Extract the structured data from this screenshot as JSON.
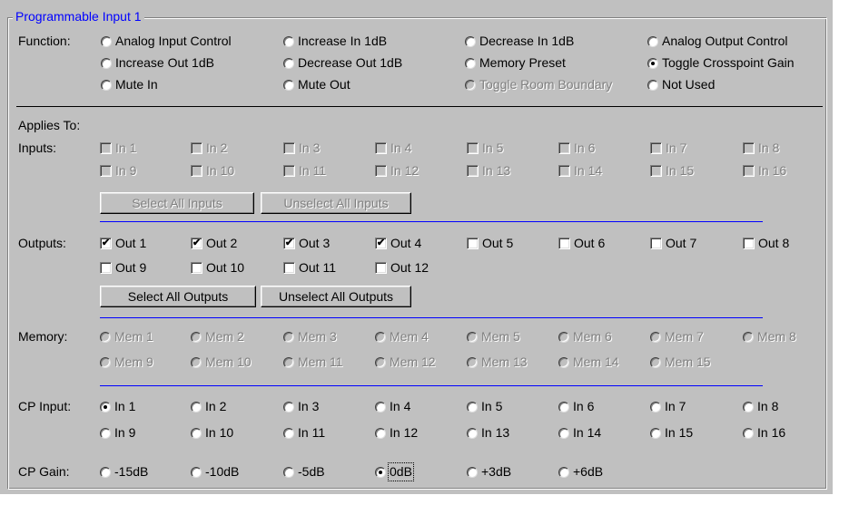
{
  "group_title": "Programmable Input 1",
  "labels": {
    "function": "Function:",
    "applies_to": "Applies To:",
    "inputs": "Inputs:",
    "outputs": "Outputs:",
    "memory": "Memory:",
    "cp_input": "CP Input:",
    "cp_gain": "CP Gain:"
  },
  "function_options": [
    {
      "label": "Analog Input Control",
      "checked": false,
      "disabled": false
    },
    {
      "label": "Increase In 1dB",
      "checked": false,
      "disabled": false
    },
    {
      "label": "Decrease In 1dB",
      "checked": false,
      "disabled": false
    },
    {
      "label": "Analog Output Control",
      "checked": false,
      "disabled": false
    },
    {
      "label": "Increase Out 1dB",
      "checked": false,
      "disabled": false
    },
    {
      "label": "Decrease Out 1dB",
      "checked": false,
      "disabled": false
    },
    {
      "label": "Memory Preset",
      "checked": false,
      "disabled": false
    },
    {
      "label": "Toggle Crosspoint Gain",
      "checked": true,
      "disabled": false
    },
    {
      "label": "Mute In",
      "checked": false,
      "disabled": false
    },
    {
      "label": "Mute Out",
      "checked": false,
      "disabled": false
    },
    {
      "label": "Toggle Room Boundary",
      "checked": false,
      "disabled": true
    },
    {
      "label": "Not Used",
      "checked": false,
      "disabled": false
    }
  ],
  "inputs": [
    {
      "label": "In 1",
      "checked": false
    },
    {
      "label": "In 2",
      "checked": false
    },
    {
      "label": "In 3",
      "checked": false
    },
    {
      "label": "In 4",
      "checked": false
    },
    {
      "label": "In 5",
      "checked": false
    },
    {
      "label": "In 6",
      "checked": false
    },
    {
      "label": "In 7",
      "checked": false
    },
    {
      "label": "In 8",
      "checked": false
    },
    {
      "label": "In 9",
      "checked": false
    },
    {
      "label": "In 10",
      "checked": false
    },
    {
      "label": "In 11",
      "checked": false
    },
    {
      "label": "In 12",
      "checked": false
    },
    {
      "label": "In 13",
      "checked": false
    },
    {
      "label": "In 14",
      "checked": false
    },
    {
      "label": "In 15",
      "checked": false
    },
    {
      "label": "In 16",
      "checked": false
    }
  ],
  "inputs_disabled": true,
  "input_buttons": {
    "select_all": "Select All Inputs",
    "unselect_all": "Unselect All Inputs"
  },
  "outputs": [
    {
      "label": "Out 1",
      "checked": true
    },
    {
      "label": "Out 2",
      "checked": true
    },
    {
      "label": "Out 3",
      "checked": true
    },
    {
      "label": "Out 4",
      "checked": true
    },
    {
      "label": "Out 5",
      "checked": false
    },
    {
      "label": "Out 6",
      "checked": false
    },
    {
      "label": "Out 7",
      "checked": false
    },
    {
      "label": "Out 8",
      "checked": false
    },
    {
      "label": "Out 9",
      "checked": false
    },
    {
      "label": "Out 10",
      "checked": false
    },
    {
      "label": "Out 11",
      "checked": false
    },
    {
      "label": "Out 12",
      "checked": false
    }
  ],
  "output_buttons": {
    "select_all": "Select All Outputs",
    "unselect_all": "Unselect All Outputs"
  },
  "memory": [
    {
      "label": "Mem 1"
    },
    {
      "label": "Mem 2"
    },
    {
      "label": "Mem 3"
    },
    {
      "label": "Mem 4"
    },
    {
      "label": "Mem 5"
    },
    {
      "label": "Mem 6"
    },
    {
      "label": "Mem 7"
    },
    {
      "label": "Mem 8"
    },
    {
      "label": "Mem 9"
    },
    {
      "label": "Mem 10"
    },
    {
      "label": "Mem 11"
    },
    {
      "label": "Mem 12"
    },
    {
      "label": "Mem 13"
    },
    {
      "label": "Mem 14"
    },
    {
      "label": "Mem 15"
    }
  ],
  "memory_disabled": true,
  "cp_inputs": [
    {
      "label": "In 1",
      "checked": true
    },
    {
      "label": "In 2",
      "checked": false
    },
    {
      "label": "In 3",
      "checked": false
    },
    {
      "label": "In 4",
      "checked": false
    },
    {
      "label": "In 5",
      "checked": false
    },
    {
      "label": "In 6",
      "checked": false
    },
    {
      "label": "In 7",
      "checked": false
    },
    {
      "label": "In 8",
      "checked": false
    },
    {
      "label": "In 9",
      "checked": false
    },
    {
      "label": "In 10",
      "checked": false
    },
    {
      "label": "In 11",
      "checked": false
    },
    {
      "label": "In 12",
      "checked": false
    },
    {
      "label": "In 13",
      "checked": false
    },
    {
      "label": "In 14",
      "checked": false
    },
    {
      "label": "In 15",
      "checked": false
    },
    {
      "label": "In 16",
      "checked": false
    }
  ],
  "cp_gains": [
    {
      "label": "-15dB",
      "checked": false
    },
    {
      "label": "-10dB",
      "checked": false
    },
    {
      "label": "-5dB",
      "checked": false
    },
    {
      "label": "0dB",
      "checked": true
    },
    {
      "label": "+3dB",
      "checked": false
    },
    {
      "label": "+6dB",
      "checked": false
    }
  ],
  "colors": {
    "panel": "#c0c0c0",
    "title": "#0000ff",
    "separator_blue": "#0000ff",
    "disabled_text": "#808080"
  }
}
